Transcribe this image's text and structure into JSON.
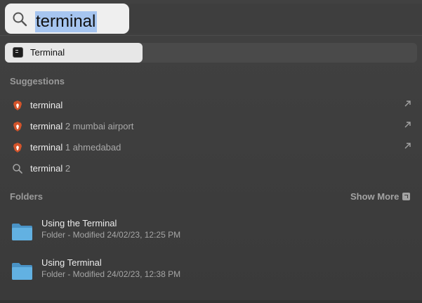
{
  "search": {
    "query": "terminal"
  },
  "top_hit": {
    "label": "Terminal",
    "icon": "terminal-app-icon"
  },
  "suggestions": {
    "header": "Suggestions",
    "items": [
      {
        "query": "terminal",
        "rest": "",
        "icon": "brave-browser-icon",
        "arrow": true
      },
      {
        "query": "terminal",
        "rest": " 2 mumbai airport",
        "icon": "brave-browser-icon",
        "arrow": true
      },
      {
        "query": "terminal",
        "rest": " 1 ahmedabad",
        "icon": "brave-browser-icon",
        "arrow": true
      },
      {
        "query": "terminal",
        "rest": " 2",
        "icon": "search-icon",
        "arrow": false
      }
    ]
  },
  "folders": {
    "header": "Folders",
    "show_more": "Show More",
    "items": [
      {
        "name": "Using the Terminal",
        "meta": "Folder - Modified 24/02/23, 12:25 PM"
      },
      {
        "name": "Using Terminal",
        "meta": "Folder - Modified 24/02/23, 12:38 PM"
      }
    ]
  },
  "colors": {
    "background": "#3b3b3b",
    "selection": "#a6c5f0",
    "folder": "#5aa7d9",
    "brave": "#d3542b"
  }
}
